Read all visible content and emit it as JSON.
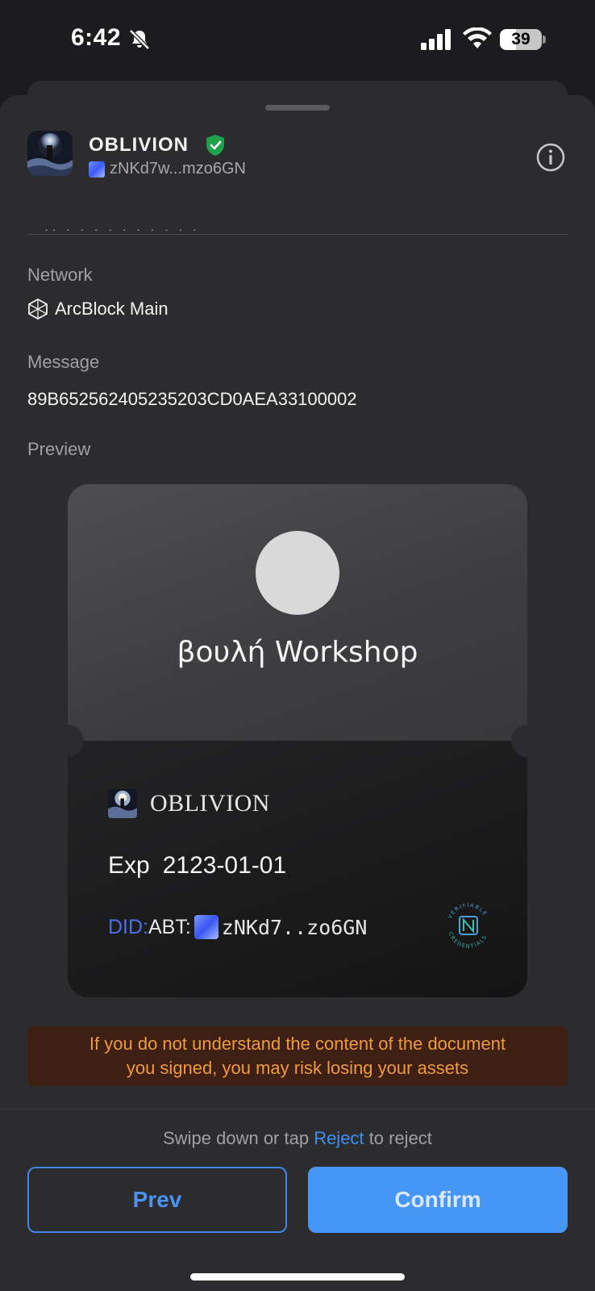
{
  "status_bar": {
    "time": "6:42",
    "battery_level": "39",
    "battery_fraction": 0.39
  },
  "header": {
    "app_name": "OBLIVION",
    "app_did": "zNKd7w...mzo6GN"
  },
  "network": {
    "label": "Network",
    "value": "ArcBlock Main"
  },
  "message": {
    "label": "Message",
    "value": "89B652562405235203CD0AEA33100002"
  },
  "preview": {
    "label": "Preview",
    "card": {
      "title": "βουλή Workshop",
      "issuer": "OBLIVION",
      "exp_label": "Exp",
      "exp_date": "2123-01-01",
      "did_prefix": "DID:",
      "did_method": "ABT:",
      "did_short": "zNKd7..zo6GN"
    }
  },
  "warning": {
    "line1": "If you do not understand the content of the document",
    "line2": "you signed, you may risk losing your assets"
  },
  "footer": {
    "hint_before": "Swipe down or tap ",
    "hint_link": "Reject",
    "hint_after": " to reject",
    "prev_label": "Prev",
    "confirm_label": "Confirm"
  },
  "colors": {
    "accent": "#4596f5",
    "warning_text": "#f09a3a",
    "warning_bg": "#3d1f13",
    "verified": "#1fa34a",
    "did_prefix": "#4f6ee8"
  },
  "icons": [
    "bell-slash-icon",
    "cellular-signal-icon",
    "wifi-icon",
    "battery-icon",
    "verified-shield-icon",
    "info-icon",
    "arcblock-network-icon",
    "verifiable-credentials-badge"
  ]
}
